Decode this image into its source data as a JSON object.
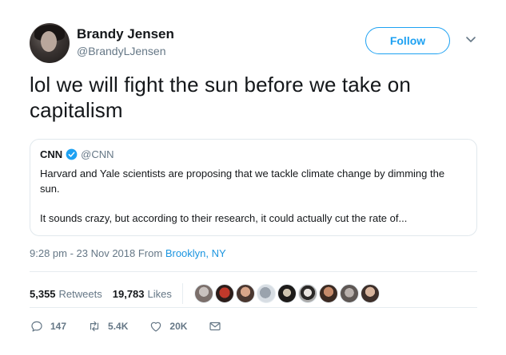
{
  "author": {
    "name": "Brandy Jensen",
    "handle": "@BrandyLJensen"
  },
  "follow_button": {
    "label": "Follow"
  },
  "tweet": {
    "text": "lol we will fight the sun before we take on capitalism"
  },
  "quoted_tweet": {
    "name": "CNN",
    "handle": "@CNN",
    "paragraph_1": "Harvard and Yale scientists are proposing that we tackle climate change by dimming the sun.",
    "paragraph_2": "It sounds crazy, but according to their research, it could actually cut the rate of..."
  },
  "meta": {
    "time_date": "9:28 pm - 23 Nov 2018 From ",
    "location": "Brooklyn, NY"
  },
  "stats": {
    "retweets_count": "5,355",
    "retweets_label": "Retweets",
    "likes_count": "19,783",
    "likes_label": "Likes"
  },
  "actions": {
    "replies": "147",
    "retweets": "5.4K",
    "likes": "20K"
  },
  "colors": {
    "accent": "#1da1f2",
    "link": "#1b95e0",
    "muted": "#657786",
    "border": "#e1e8ed"
  }
}
